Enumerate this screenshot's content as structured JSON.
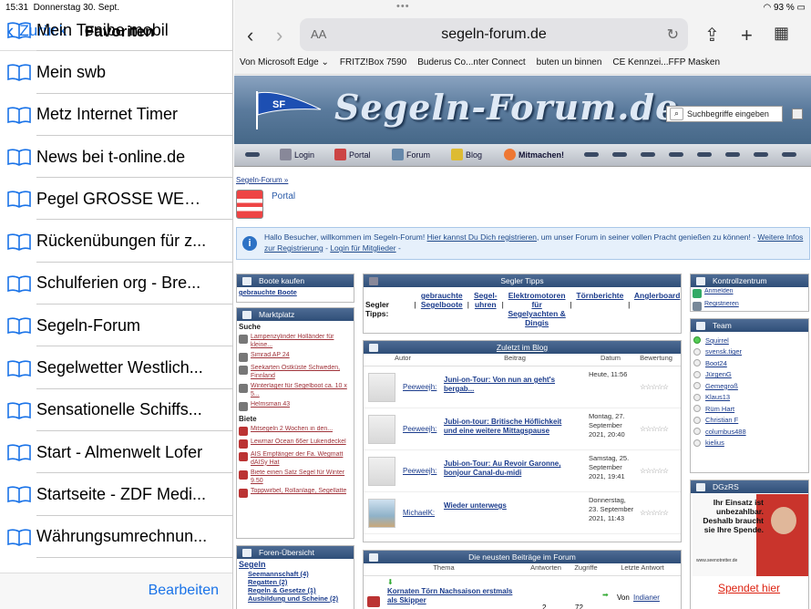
{
  "status": {
    "time": "15:31",
    "date": "Donnerstag 30. Sept.",
    "battery": "93 %"
  },
  "sidebar": {
    "back_label": "Zurück",
    "title": "Favoriten",
    "edit_label": "Bearbeiten",
    "items": [
      {
        "label": "Mein Tenibe mobil"
      },
      {
        "label": "Mein swb"
      },
      {
        "label": "Metz Internet Timer"
      },
      {
        "label": "News bei t-online.de"
      },
      {
        "label": "Pegel GROSSE WESE..."
      },
      {
        "label": "Rückenübungen für z..."
      },
      {
        "label": "Schulferien org - Bre..."
      },
      {
        "label": "Segeln-Forum"
      },
      {
        "label": "Segelwetter Westlich..."
      },
      {
        "label": "Sensationelle Schiffs..."
      },
      {
        "label": "Start - Almenwelt Lofer"
      },
      {
        "label": "Startseite - ZDF Medi..."
      },
      {
        "label": "Währungsumrechnun..."
      }
    ]
  },
  "browser": {
    "address": "segeln-forum.de",
    "aa_label": "AA",
    "bookmarks": [
      "Von Microsoft Edge ⌄",
      "FRITZ!Box 7590",
      "Buderus Co...nter Connect",
      "buten un binnen",
      "CE Kennzei...FFP Masken"
    ]
  },
  "site": {
    "logo": "Segeln-Forum.de",
    "flag_text": "SF",
    "search_placeholder": "Suchbegriffe eingeben",
    "menu": [
      "Login",
      "Portal",
      "Forum",
      "Blog",
      "Mitmachen!"
    ],
    "breadcrumb": "Segeln-Forum »",
    "portal_title": "Portal",
    "welcome": {
      "a": "Hallo Besucher, willkommen im Segeln-Forum! ",
      "b": "Hier kannst Du Dich registrieren",
      "c": ", um unser Forum in seiner vollen Pracht genießen zu können! - ",
      "d": "Weitere Infos zur Registrierung",
      "e": " - ",
      "f": "Login für Mitglieder",
      "g": " -"
    },
    "boote": {
      "title": "Boote kaufen",
      "link": "gebrauchte Boote"
    },
    "markt": {
      "title": "Marktplatz",
      "suche": "Suche",
      "biete": "Biete",
      "suche_items": [
        "Lampenzylinder Holländer für kleine...",
        "Simrad AP 24",
        "Seekarten Ostküste Schweden, Finnland",
        "Winterlager für Segelboot ca. 10 x 5...",
        "Helmsman 43"
      ],
      "biete_items": [
        "Mitsegeln 2 Wochen in den...",
        "Lewmar Ocean 66er Lukendeckel",
        "AIS Empfänger der Fa. Wegmatt dAISy Hat",
        "Biete einen Satz Segel für Winter 9.50",
        "Toppwirbel, Rollanlage, Segellatte"
      ]
    },
    "foren": {
      "title": "Foren-Übersicht",
      "head": "Segeln",
      "items": [
        "Seemannschaft (4)",
        "Regatten (2)",
        "Regeln & Gesetze (1)",
        "Ausbildung und Scheine (2)"
      ]
    },
    "tipps": {
      "title": "Segler Tipps",
      "label": "Segler Tipps:",
      "items": [
        "gebrauchte Segelboote",
        "Segel-uhren",
        "Elektromotoren für Segelyachten & Dingis",
        "Törnberichte",
        "Anglerboard"
      ]
    },
    "blog": {
      "title": "Zuletzt im Blog",
      "cols": [
        "Autor",
        "Beitrag",
        "Datum",
        "Bewertung"
      ],
      "rows": [
        {
          "author": "Peeweejh",
          "title": "Juni-on-Tour: Von nun an geht's bergab...",
          "date": "Heute, 11:56"
        },
        {
          "author": "Peeweejh",
          "title": "Jubi-on-tour: Britische Höflichkeit und eine weitere Mittagspause",
          "date": "Montag, 27. September 2021, 20:40"
        },
        {
          "author": "Peeweejh",
          "title": "Jubi-on-Tour: Au Revoir Garonne, bonjour Canal-du-midi",
          "date": "Samstag, 25. September 2021, 19:41"
        },
        {
          "author": "MichaelK",
          "title": "Wieder unterwegs",
          "date": "Donnerstag, 23. September 2021, 11:43"
        }
      ],
      "stars": "☆☆☆☆☆"
    },
    "neueste": {
      "title": "Die neusten Beiträge im Forum",
      "cols": [
        "Thema",
        "Antworten",
        "Zugriffe",
        "Letzte Antwort"
      ],
      "row": {
        "title": "Kornaten Törn Nachsaison erstmals als Skipper",
        "answers": "2",
        "views": "72",
        "last_by": "Von",
        "last_user": "Indianer"
      }
    },
    "kontroll": {
      "title": "Kontrollzentrum",
      "items": [
        "Anmelden",
        "Registrieren"
      ]
    },
    "team": {
      "title": "Team",
      "members": [
        "Squirrel",
        "svensk.tiger",
        "Boot24",
        "JürgenG",
        "Gemegroß",
        "Klaus13",
        "Rüm Hart",
        "Christian F",
        "columbus488",
        "kielius"
      ]
    },
    "dgzrs": {
      "title": "DGzRS",
      "ad_text": "Ihr Einsatz ist unbezahlbar. Deshalb braucht sie Ihre Spende.",
      "ad_url": "www.seenotretter.de",
      "button": "Spendet hier"
    }
  }
}
